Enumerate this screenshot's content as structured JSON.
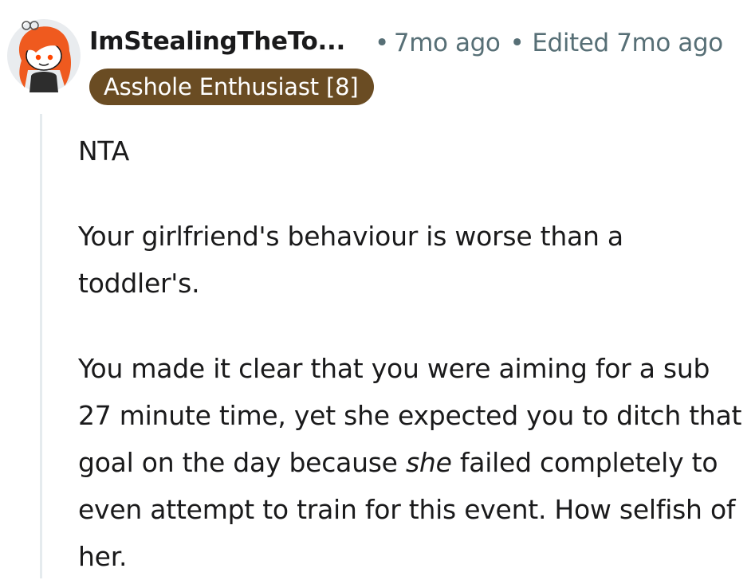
{
  "comment": {
    "author": "ImStealingTheTo...",
    "timestamp": "7mo ago",
    "edited": "Edited 7mo ago",
    "flair": "Asshole Enthusiast [8]",
    "paragraphs": {
      "p1": "NTA",
      "p2": "Your girlfriend's behaviour is worse than a toddler's.",
      "p3_part1": "You made it clear that you were aiming for a sub 27 minute time, yet she expected you to ditch that goal on the day because ",
      "p3_emphasis": "she",
      "p3_part2": " failed completely to even attempt to train for this event. How selfish of her."
    }
  },
  "meta_separator": "•",
  "colors": {
    "flair_background": "#6a4c23",
    "flair_text": "#ffffff",
    "meta_text": "#576f76",
    "body_text": "#1a1a1b",
    "thread_line": "#e5ebee",
    "avatar_hair": "#ef5a1f"
  },
  "icons": {
    "avatar": "reddit-snoo-avatar-icon"
  }
}
